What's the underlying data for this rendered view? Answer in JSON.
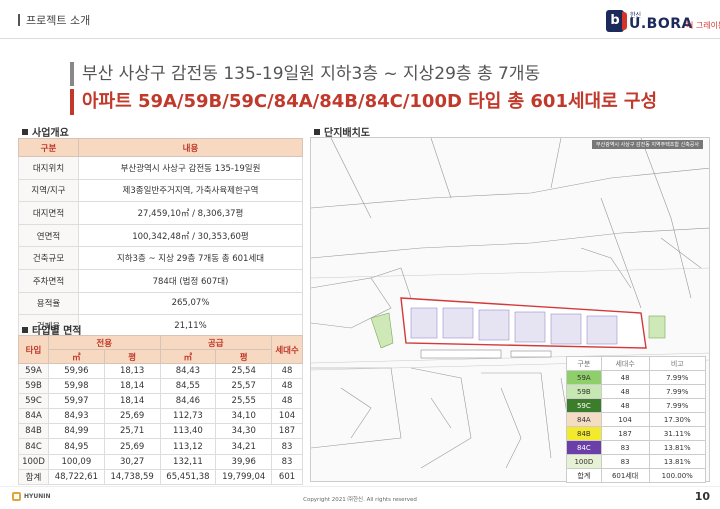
{
  "header": {
    "section": "프로젝트 소개",
    "logo_small": "한신",
    "logo_main": "U.BORA",
    "logo_sub": "더 그레이튼"
  },
  "headline": {
    "line1": "부산 사상구 감전동 135-19일원 지하3층 ~ 지상29층  총 7개동",
    "line2": "아파트 59A/59B/59C/84A/84B/84C/100D 타입 총 601세대로 구성"
  },
  "overview": {
    "title": "사업개요",
    "headers": [
      "구분",
      "내용"
    ],
    "rows": [
      [
        "대지위치",
        "부산광역시 사상구 감전동 135-19일원"
      ],
      [
        "지역/지구",
        "제3종일반주거지역, 가축사육제한구역"
      ],
      [
        "대지면적",
        "27,459,10㎡ / 8,306,37평"
      ],
      [
        "연면적",
        "100,342,48㎡ / 30,353,60평"
      ],
      [
        "건축규모",
        "지하3층 ~ 지상 29층 7개동 총 601세대"
      ],
      [
        "주차면적",
        "784대 (법정 607대)"
      ],
      [
        "용적율",
        "265,07%"
      ],
      [
        "건폐율",
        "21,11%"
      ]
    ]
  },
  "area": {
    "title": "타입별 면적",
    "h_type": "타입",
    "h_exclusive": "전용",
    "h_supply": "공급",
    "h_units": "세대수",
    "h_m2": "㎡",
    "h_py": "평",
    "rows": [
      [
        "59A",
        "59,96",
        "18,13",
        "84,43",
        "25,54",
        "48"
      ],
      [
        "59B",
        "59,98",
        "18,14",
        "84,55",
        "25,57",
        "48"
      ],
      [
        "59C",
        "59,97",
        "18,14",
        "84,46",
        "25,55",
        "48"
      ],
      [
        "84A",
        "84,93",
        "25,69",
        "112,73",
        "34,10",
        "104"
      ],
      [
        "84B",
        "84,99",
        "25,71",
        "113,40",
        "34,30",
        "187"
      ],
      [
        "84C",
        "84,95",
        "25,69",
        "113,12",
        "34,21",
        "83"
      ],
      [
        "100D",
        "100,09",
        "30,27",
        "132,11",
        "39,96",
        "83"
      ],
      [
        "합계",
        "48,722,61",
        "14,738,59",
        "65,451,38",
        "19,799,04",
        "601"
      ]
    ]
  },
  "site": {
    "title": "단지배치도",
    "note": "부산광역시 사상구 감전동 지역주택조합 신축공사",
    "legend_headers": [
      "구분",
      "세대수",
      "비고"
    ],
    "legend": [
      {
        "type": "59A",
        "units": "48",
        "ratio": "7.99%",
        "color": "#8fcf6a"
      },
      {
        "type": "59B",
        "units": "48",
        "ratio": "7.99%",
        "color": "#c7e8b2"
      },
      {
        "type": "59C",
        "units": "48",
        "ratio": "7.99%",
        "color": "#3c7d2b"
      },
      {
        "type": "84A",
        "units": "104",
        "ratio": "17.30%",
        "color": "#f5ddc4"
      },
      {
        "type": "84B",
        "units": "187",
        "ratio": "31.11%",
        "color": "#f3e92d"
      },
      {
        "type": "84C",
        "units": "83",
        "ratio": "13.81%",
        "color": "#6b3fa8"
      },
      {
        "type": "100D",
        "units": "83",
        "ratio": "13.81%",
        "color": "#e7f1d4"
      },
      {
        "type": "합계",
        "units": "601세대",
        "ratio": "100.00%",
        "color": "#ffffff"
      }
    ]
  },
  "footer": {
    "copyright": "Copyright 2021 ㈜한신. All rights reserved",
    "page": "10",
    "brand": "HYUNIN"
  }
}
